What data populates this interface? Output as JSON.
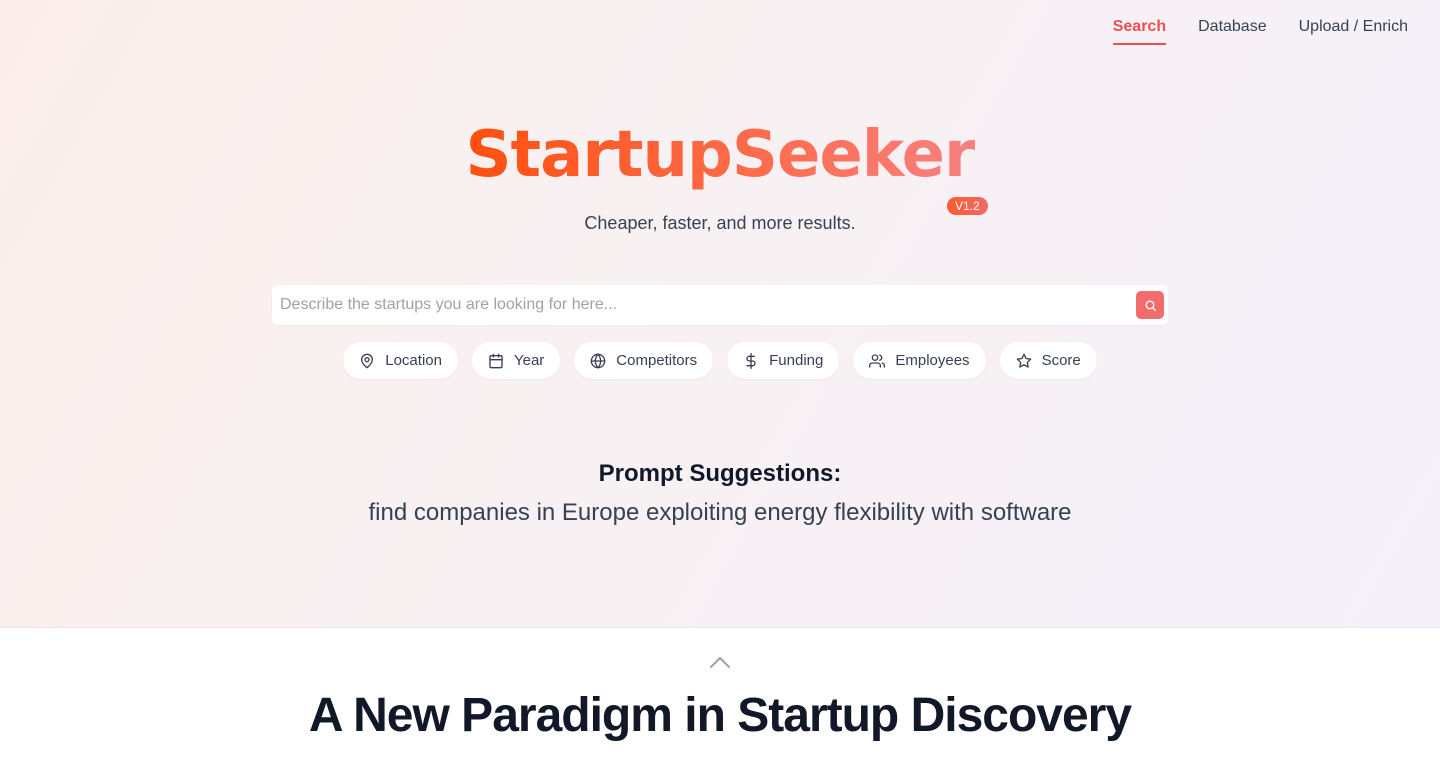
{
  "nav": {
    "items": [
      {
        "label": "Search",
        "active": true
      },
      {
        "label": "Database",
        "active": false
      },
      {
        "label": "Upload / Enrich",
        "active": false
      }
    ]
  },
  "brand": {
    "title": "StartupSeeker",
    "version": "V1.2",
    "tagline": "Cheaper, faster, and more results."
  },
  "search": {
    "placeholder": "Describe the startups you are looking for here...",
    "value": "",
    "button_icon": "search-icon"
  },
  "filters": [
    {
      "label": "Location",
      "icon": "map-pin-icon"
    },
    {
      "label": "Year",
      "icon": "calendar-icon"
    },
    {
      "label": "Competitors",
      "icon": "globe-icon"
    },
    {
      "label": "Funding",
      "icon": "dollar-icon"
    },
    {
      "label": "Employees",
      "icon": "users-icon"
    },
    {
      "label": "Score",
      "icon": "star-icon"
    }
  ],
  "suggestions": {
    "title": "Prompt Suggestions:",
    "text": "find companies in Europe exploiting energy flexibility with software"
  },
  "section": {
    "title": "A New Paradigm in Startup Discovery"
  },
  "colors": {
    "accent": "#f04e4e",
    "brand_start": "#ff4f0f",
    "brand_end": "#f88080"
  }
}
